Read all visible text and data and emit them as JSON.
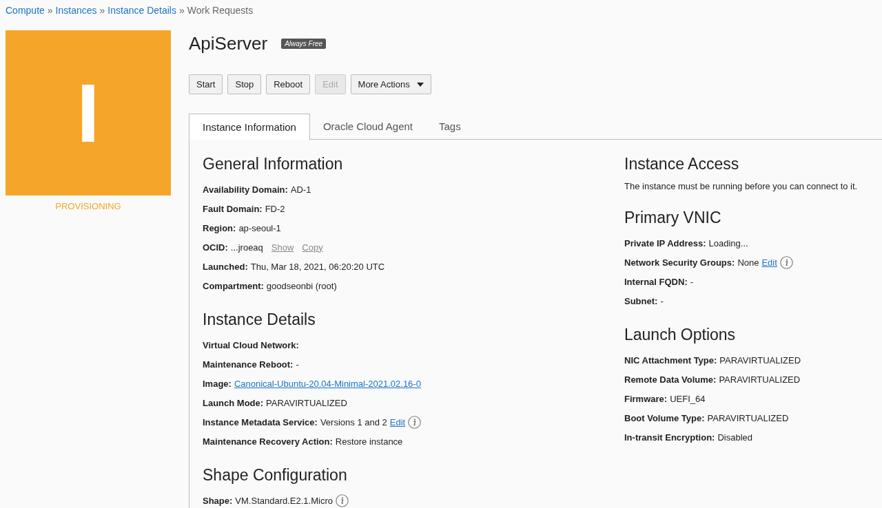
{
  "breadcrumb": [
    {
      "label": "Compute",
      "link": true
    },
    {
      "label": "Instances",
      "link": true
    },
    {
      "label": "Instance Details",
      "link": true
    },
    {
      "label": "Work Requests",
      "link": false
    }
  ],
  "breadcrumb_separator": "»",
  "avatar": {
    "letter": "I",
    "status": "PROVISIONING"
  },
  "title": "ApiServer",
  "badge": "Always Free",
  "buttons": [
    {
      "label": "Start",
      "disabled": false,
      "kind": "plain"
    },
    {
      "label": "Stop",
      "disabled": false,
      "kind": "plain"
    },
    {
      "label": "Reboot",
      "disabled": false,
      "kind": "plain"
    },
    {
      "label": "Edit",
      "disabled": true,
      "kind": "plain"
    },
    {
      "label": "More Actions",
      "disabled": false,
      "kind": "dropdown"
    }
  ],
  "tabs": [
    {
      "label": "Instance Information",
      "selected": true
    },
    {
      "label": "Oracle Cloud Agent",
      "selected": false
    },
    {
      "label": "Tags",
      "selected": false
    }
  ],
  "left_sections": [
    {
      "heading": "General Information",
      "fields": [
        {
          "label": "Availability Domain:",
          "parts": [
            {
              "kind": "text",
              "text": "AD-1"
            }
          ]
        },
        {
          "label": "Fault Domain:",
          "parts": [
            {
              "kind": "text",
              "text": "FD-2"
            }
          ]
        },
        {
          "label": "Region:",
          "parts": [
            {
              "kind": "text",
              "text": "ap-seoul-1"
            }
          ]
        },
        {
          "label": "OCID:",
          "parts": [
            {
              "kind": "text",
              "text": "...jroeaq"
            },
            {
              "kind": "action",
              "text": "Show"
            },
            {
              "kind": "action",
              "text": "Copy"
            }
          ]
        },
        {
          "label": "Launched:",
          "parts": [
            {
              "kind": "text",
              "text": "Thu, Mar 18, 2021, 06:20:20 UTC"
            }
          ]
        },
        {
          "label": "Compartment:",
          "parts": [
            {
              "kind": "text",
              "text": "goodseonbi (root)"
            }
          ]
        }
      ]
    },
    {
      "heading": "Instance Details",
      "fields": [
        {
          "label": "Virtual Cloud Network:"
        },
        {
          "label": "Maintenance Reboot:",
          "parts": [
            {
              "kind": "text",
              "text": "-"
            }
          ]
        },
        {
          "label": "Image:",
          "parts": [
            {
              "kind": "link",
              "text": "Canonical-Ubuntu-20.04-Minimal-2021.02.16-0"
            }
          ]
        },
        {
          "label": "Launch Mode:",
          "parts": [
            {
              "kind": "text",
              "text": "PARAVIRTUALIZED"
            }
          ]
        },
        {
          "label": "Instance Metadata Service:",
          "parts": [
            {
              "kind": "text",
              "text": "Versions 1 and 2"
            },
            {
              "kind": "link",
              "text": "Edit"
            },
            {
              "kind": "info"
            }
          ]
        },
        {
          "label": "Maintenance Recovery Action:",
          "parts": [
            {
              "kind": "text",
              "text": "Restore instance"
            }
          ]
        }
      ]
    },
    {
      "heading": "Shape Configuration",
      "fields": [
        {
          "label": "Shape:",
          "parts": [
            {
              "kind": "text",
              "text": "VM.Standard.E2.1.Micro"
            },
            {
              "kind": "info"
            }
          ]
        }
      ]
    }
  ],
  "right_sections": [
    {
      "heading": "Instance Access",
      "note": "The instance must be running before you can connect to it."
    },
    {
      "heading": "Primary VNIC",
      "fields": [
        {
          "label": "Private IP Address:",
          "parts": [
            {
              "kind": "text",
              "text": "Loading..."
            }
          ]
        },
        {
          "label": "Network Security Groups:",
          "parts": [
            {
              "kind": "text",
              "text": "None"
            },
            {
              "kind": "link",
              "text": "Edit"
            },
            {
              "kind": "info"
            }
          ]
        },
        {
          "label": "Internal FQDN:",
          "parts": [
            {
              "kind": "text",
              "text": "-"
            }
          ]
        },
        {
          "label": "Subnet:",
          "parts": [
            {
              "kind": "text",
              "text": "-"
            }
          ]
        }
      ]
    },
    {
      "heading": "Launch Options",
      "fields": [
        {
          "label": "NIC Attachment Type:",
          "parts": [
            {
              "kind": "text",
              "text": "PARAVIRTUALIZED"
            }
          ]
        },
        {
          "label": "Remote Data Volume:",
          "parts": [
            {
              "kind": "text",
              "text": "PARAVIRTUALIZED"
            }
          ]
        },
        {
          "label": "Firmware:",
          "parts": [
            {
              "kind": "text",
              "text": "UEFI_64"
            }
          ]
        },
        {
          "label": "Boot Volume Type:",
          "parts": [
            {
              "kind": "text",
              "text": "PARAVIRTUALIZED"
            }
          ]
        },
        {
          "label": "In-transit Encryption:",
          "parts": [
            {
              "kind": "text",
              "text": "Disabled"
            }
          ]
        }
      ]
    }
  ]
}
